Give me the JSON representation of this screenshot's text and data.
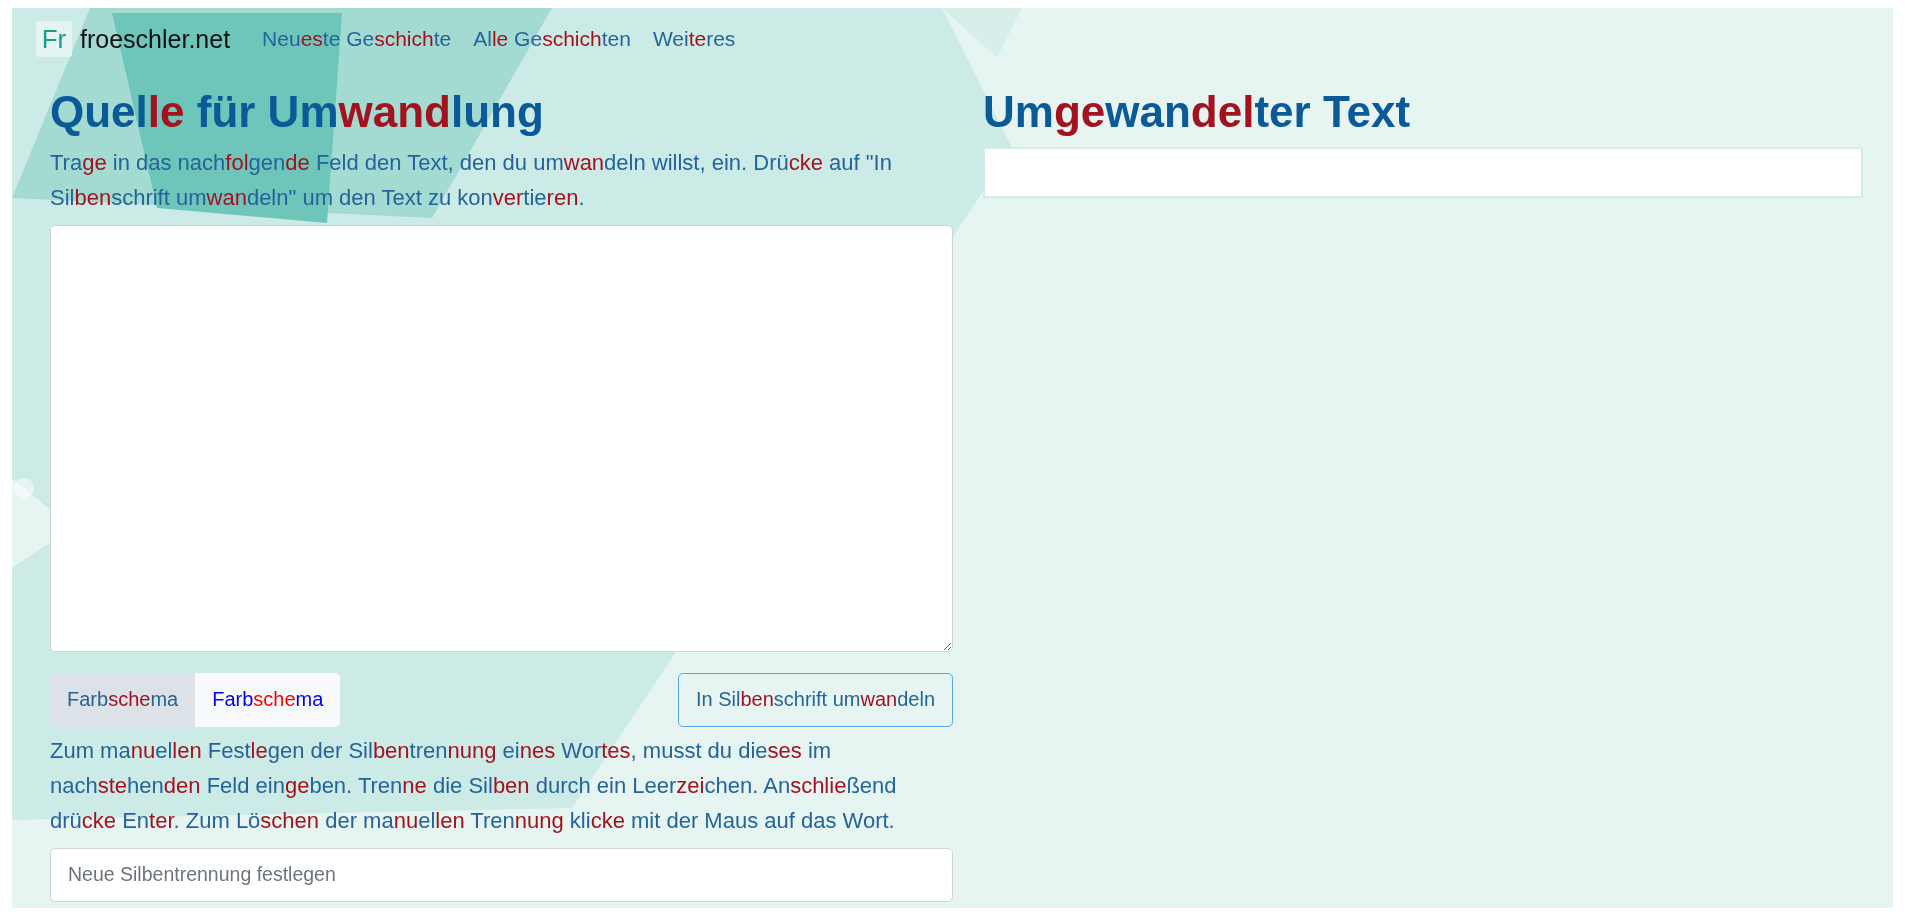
{
  "site": {
    "logo": "Fr",
    "name": "froeschler.net"
  },
  "nav": [
    {
      "parts": [
        "Neu",
        "es",
        "te Ge",
        "schich",
        "te"
      ]
    },
    {
      "parts": [
        "Al",
        "le",
        " Ge",
        "schich",
        "ten"
      ]
    },
    {
      "parts": [
        "Wei",
        "te",
        "res"
      ]
    }
  ],
  "source": {
    "title": [
      "Quel",
      "le",
      " für Um",
      "wand",
      "lung"
    ],
    "instructions": [
      "Tra",
      "ge",
      " in das nach",
      "fol",
      "gen",
      "de",
      " Feld den Text, den du um",
      "wan",
      "deln willst, ein. Drü",
      "cke",
      " auf \"In Sil",
      "ben",
      "schrift um",
      "wan",
      "deln\" um den Text zu kon",
      "ver",
      "tie",
      "ren",
      "."
    ],
    "color_schemes": [
      {
        "parts": [
          "Farb",
          "sche",
          "ma"
        ],
        "selected": true,
        "kind": "muted"
      },
      {
        "parts": [
          "Farb",
          "sche",
          "ma"
        ],
        "selected": false,
        "kind": "bright"
      }
    ],
    "convert_button": [
      "In Sil",
      "ben",
      "schrift um",
      "wan",
      "deln"
    ],
    "hyphenation_help": [
      "Zum ma",
      "nu",
      "el",
      "len",
      " Fest",
      "le",
      "gen der Sil",
      "ben",
      "tren",
      "nung",
      " ei",
      "nes",
      " Wor",
      "tes",
      ", musst du die",
      "ses",
      " im nach",
      "ste",
      "hen",
      "den",
      " Feld ein",
      "ge",
      "ben. Tren",
      "ne",
      " die Sil",
      "ben",
      " durch ein Leer",
      "zei",
      "chen. An",
      "schlie",
      "ßend drü",
      "cke",
      " En",
      "ter",
      ". Zum Lö",
      "schen",
      " der ma",
      "nu",
      "el",
      "len",
      " Tren",
      "nung",
      " kli",
      "cke",
      " mit der Maus auf das Wort."
    ],
    "hyphenation_field": {
      "placeholder": "Neue Silbentrennung festlegen"
    }
  },
  "output": {
    "title": [
      "Um",
      "ge",
      "wan",
      "del",
      "ter Text"
    ]
  }
}
